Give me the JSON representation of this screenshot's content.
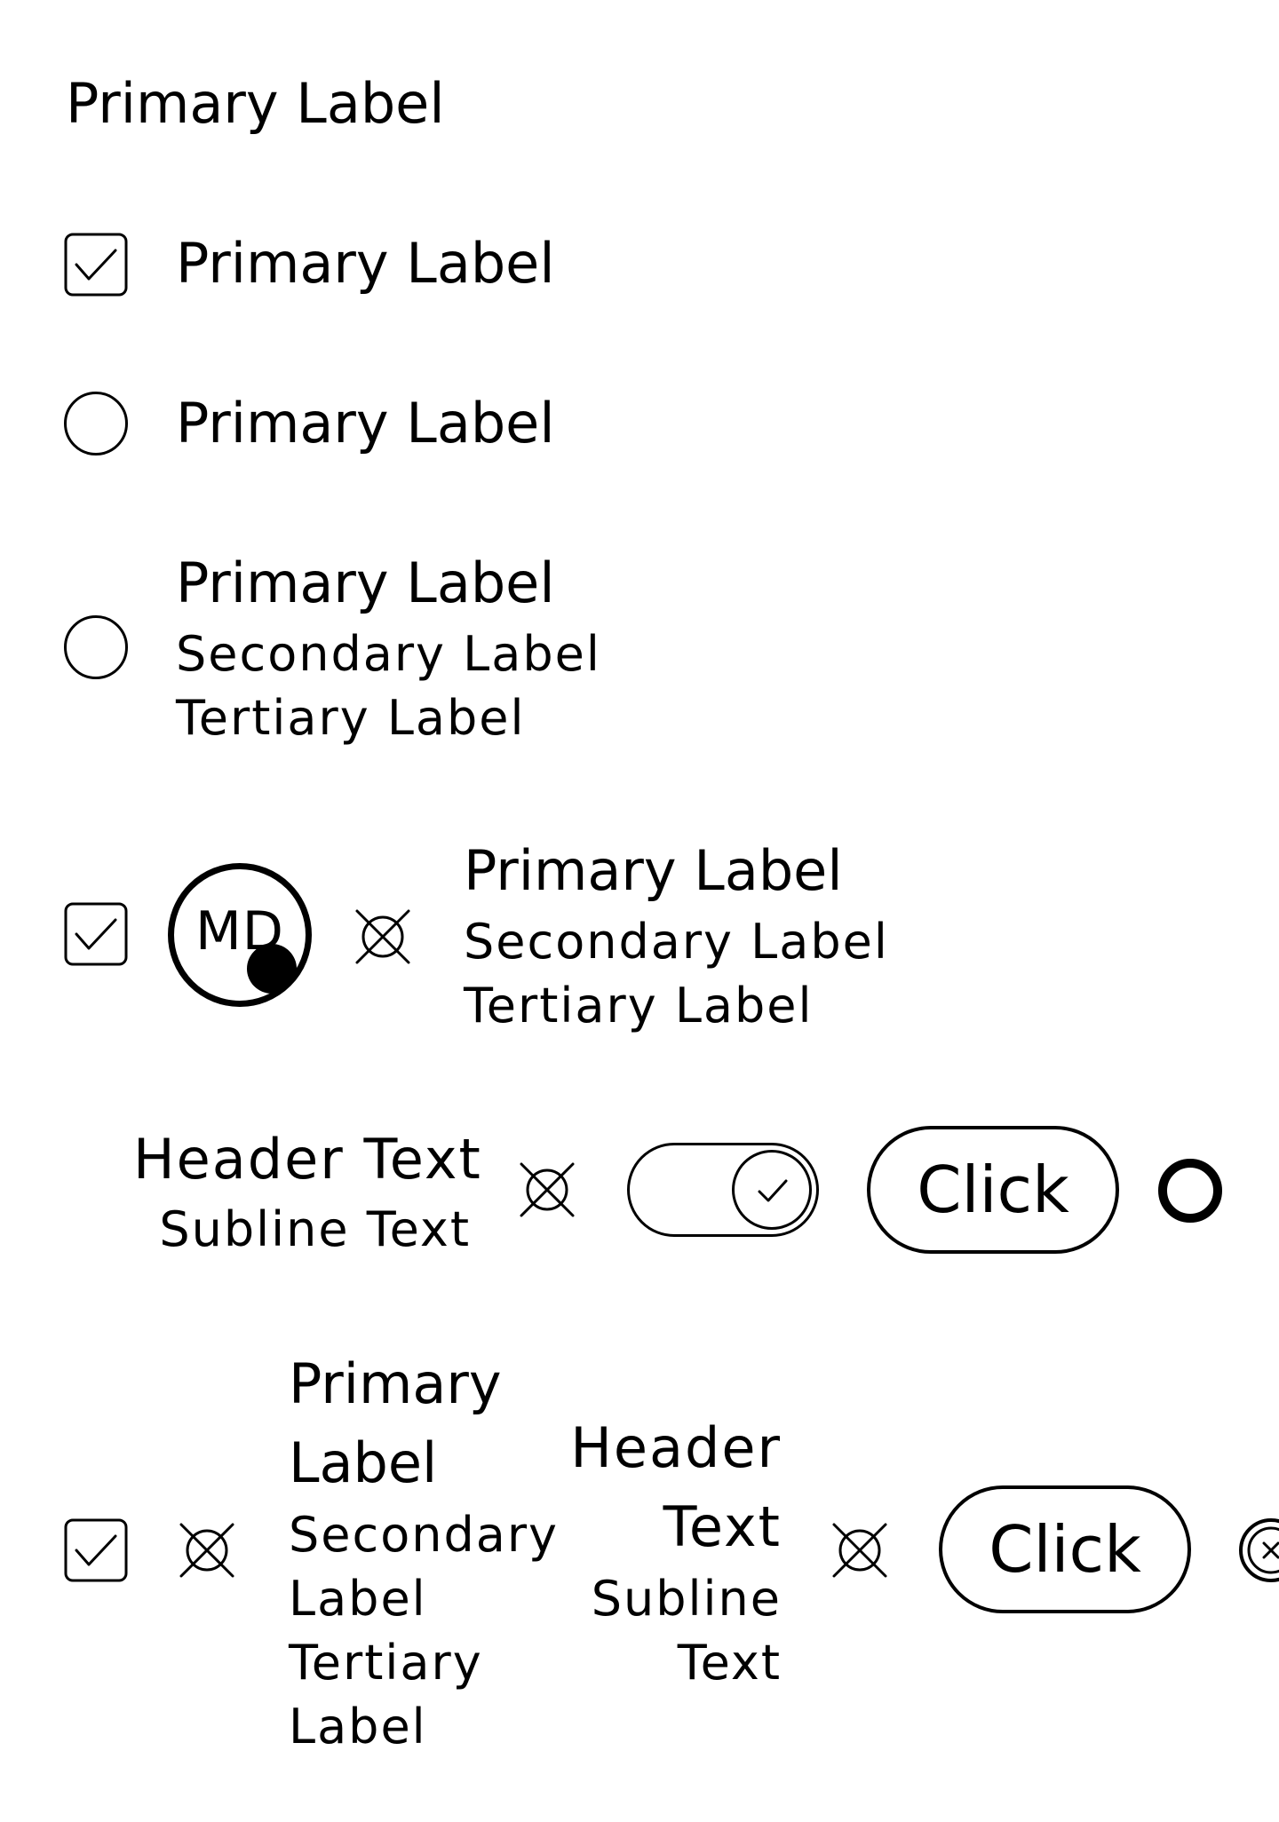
{
  "row1": {
    "primary": "Primary Label"
  },
  "row2": {
    "primary": "Primary Label",
    "icon": "checkbox-checked-icon"
  },
  "row3": {
    "primary": "Primary Label",
    "icon": "radio-empty-icon"
  },
  "row4": {
    "primary": "Primary Label",
    "secondary": "Secondary Label",
    "tertiary": "Tertiary Label",
    "icon": "radio-empty-icon"
  },
  "row5": {
    "avatar_initials": "MD",
    "primary": "Primary Label",
    "secondary": "Secondary Label",
    "tertiary": "Tertiary Label",
    "icons": [
      "checkbox-checked-icon",
      "avatar",
      "x-circle-icon"
    ]
  },
  "row6": {
    "header": "Header Text",
    "subline": "Subline Text",
    "toggle_on": true,
    "button_label": "Click"
  },
  "row7": {
    "primary_line1": "Primary",
    "primary_line2": "Label",
    "secondary_line1": "Secondary",
    "secondary_line2": "Label",
    "tertiary_line1": "Tertiary",
    "tertiary_line2": "Label",
    "header_line1": "Header",
    "header_line2": "Text",
    "subline_line1": "Subline",
    "subline_line2": "Text",
    "button_label": "Click"
  }
}
